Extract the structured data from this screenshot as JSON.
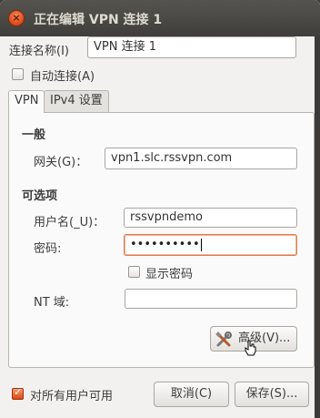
{
  "window": {
    "title": "正在编辑 VPN 连接 1",
    "close": "×"
  },
  "connection": {
    "name_label": "连接名称(I)",
    "name_value": "VPN 连接 1",
    "autoconnect_label": "自动连接(A)",
    "autoconnect_checked": false
  },
  "tabs": [
    {
      "label": "VPN",
      "active": true
    },
    {
      "label": "IPv4 设置",
      "active": false
    }
  ],
  "general": {
    "heading": "一般",
    "gateway_label": "网关(G)：",
    "gateway_value": "vpn1.slc.rssvpn.com"
  },
  "optional": {
    "heading": "可选项",
    "username_label": "用户名(_U)：",
    "username_value": "rssvpndemo",
    "password_label": "密码:",
    "password_value": "••••••••••",
    "show_password_label": "显示密码",
    "show_password_checked": false,
    "nt_domain_label": "NT 域:",
    "nt_domain_value": ""
  },
  "advanced_button": {
    "label": "高级(V)...",
    "icon": "tools-icon"
  },
  "footer": {
    "all_users_label": "对所有用户可用",
    "all_users_checked": true,
    "cancel_label": "取消(C)",
    "save_label": "保存(S)..."
  }
}
